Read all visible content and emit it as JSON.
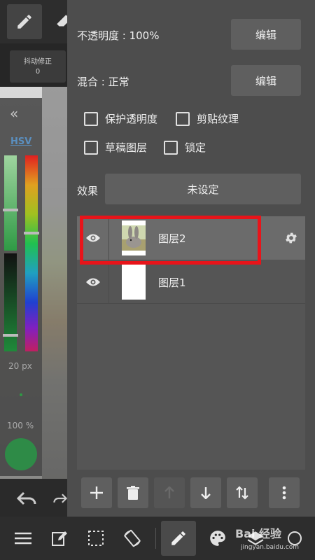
{
  "background_app": {
    "stabilizer_label": "抖动修正",
    "stabilizer_value": "0",
    "color_mode_label": "HSV",
    "brush_size": "20 px",
    "brush_opacity": "100 %",
    "current_color": "#2e8b47"
  },
  "layer_panel": {
    "opacity_label": "不透明度 : 100%",
    "opacity_edit_label": "编辑",
    "blend_label": "混合 : 正常",
    "blend_edit_label": "编辑",
    "checkboxes": {
      "protect_alpha": "保护透明度",
      "clipping": "剪贴纹理",
      "draft_layer": "草稿图层",
      "lock": "锁定"
    },
    "effect_label": "效果",
    "effect_value": "未设定",
    "layers": [
      {
        "name": "图层2",
        "visible": true,
        "selected": true,
        "thumb": "rabbit-image"
      },
      {
        "name": "图层1",
        "visible": true,
        "selected": false,
        "thumb": "blank"
      }
    ],
    "highlight_color": "#e8141a"
  },
  "watermark": {
    "text": "Bai 经验",
    "sub": "jingyan.baidu.com"
  }
}
